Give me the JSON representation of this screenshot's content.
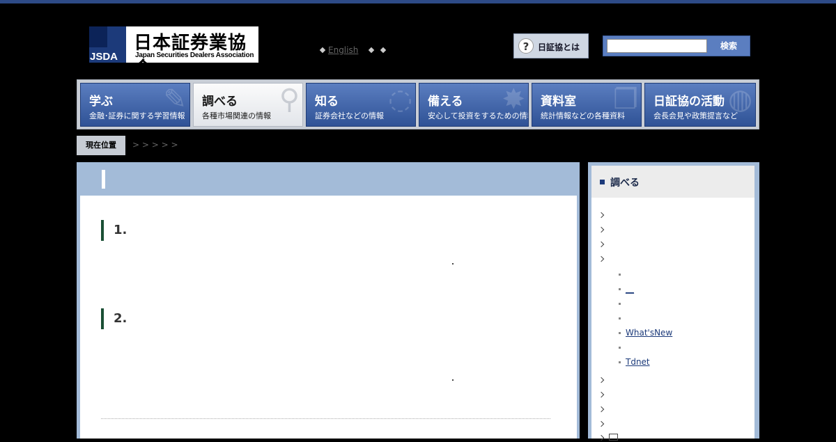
{
  "logo": {
    "org_name_ja": "日本証券業協会",
    "abbr": "JSDA",
    "org_name_en": "Japan Securities Dealers Association"
  },
  "lang": {
    "english": "English"
  },
  "about": {
    "q": "?",
    "label": "日証協とは"
  },
  "search": {
    "button": "検索",
    "value": ""
  },
  "nav": [
    {
      "title": "学ぶ",
      "sub": "金融･証券に関する学習情報"
    },
    {
      "title": "調べる",
      "sub": "各種市場関連の情報"
    },
    {
      "title": "知る",
      "sub": "証券会社などの情報"
    },
    {
      "title": "備える",
      "sub": "安心して投資をするための情報"
    },
    {
      "title": "資料室",
      "sub": "統計情報などの各種資料"
    },
    {
      "title": "日証協の活動",
      "sub": "会長会見や政策提言など"
    }
  ],
  "breadcrumb": {
    "label": "現在位置",
    "path": " > > > > >"
  },
  "main": {
    "sections": [
      {
        "num": "1."
      },
      {
        "num": "2."
      }
    ]
  },
  "sidebar": {
    "title": "調べる",
    "subitems": [
      {
        "label": ""
      },
      {
        "label": "__"
      },
      {
        "label": ""
      },
      {
        "label": ""
      },
      {
        "label": "What'sNew"
      },
      {
        "label": ""
      },
      {
        "label": "Tdnet"
      }
    ]
  },
  "colors": {
    "brand": "#1c3a7a",
    "nav": "#3c62a8",
    "panel": "#a3bbd8",
    "section_bar": "#1a4f34"
  }
}
